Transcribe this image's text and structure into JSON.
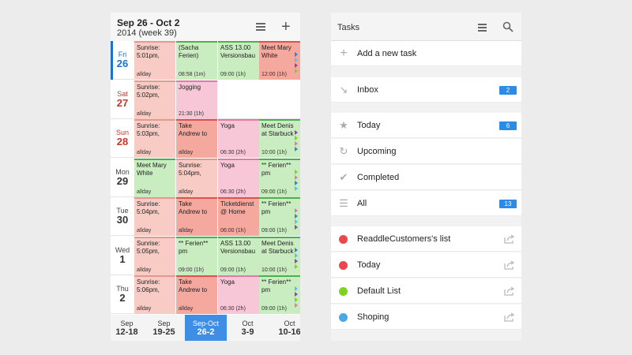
{
  "calendar": {
    "title": "Sep 26 - Oct 2",
    "subtitle": "2014 (week 39)",
    "days": [
      {
        "name": "Fri",
        "num": "26",
        "kind": "today",
        "events": [
          {
            "text": "Sunrise:\n5:01pm,",
            "time": "allday",
            "color": "sun"
          },
          {
            "text": "(Sacha\nFerien)",
            "time": "08:58 (1m)",
            "color": "grn"
          },
          {
            "text": "ASS 13.00\nVersionsbau",
            "time": "09:00 (1h)",
            "color": "grn"
          },
          {
            "text": "Meet Mary\nWhite",
            "time": "12:00 (1h)",
            "color": "red"
          }
        ]
      },
      {
        "name": "Sat",
        "num": "27",
        "kind": "weekend",
        "events": [
          {
            "text": "Sunrise:\n5:02pm,",
            "time": "allday",
            "color": "sun"
          },
          {
            "text": "Jogging",
            "time": "21:30 (1h)",
            "color": "pink"
          }
        ]
      },
      {
        "name": "Sun",
        "num": "28",
        "kind": "weekend",
        "events": [
          {
            "text": "Sunrise:\n5:03pm,",
            "time": "allday",
            "color": "sun"
          },
          {
            "text": "Take\nAndrew to",
            "time": "allday",
            "color": "red"
          },
          {
            "text": "Yoga",
            "time": "06:30 (2h)",
            "color": "pink"
          },
          {
            "text": "Meet Denis\nat Starbuck",
            "time": "10:00 (1h)",
            "color": "grn"
          }
        ]
      },
      {
        "name": "Mon",
        "num": "29",
        "kind": "normal",
        "events": [
          {
            "text": "Meet Mary\nWhite",
            "time": "allday",
            "color": "grn"
          },
          {
            "text": "Sunrise:\n5:04pm,",
            "time": "allday",
            "color": "sun"
          },
          {
            "text": "Yoga",
            "time": "06:30 (2h)",
            "color": "pink"
          },
          {
            "text": "** Ferien**\npm",
            "time": "09:00 (1h)",
            "color": "grn"
          }
        ]
      },
      {
        "name": "Tue",
        "num": "30",
        "kind": "normal",
        "events": [
          {
            "text": "Sunrise:\n5:04pm,",
            "time": "allday",
            "color": "sun"
          },
          {
            "text": "Take\nAndrew to",
            "time": "allday",
            "color": "red"
          },
          {
            "text": "Ticketdienst\n@ Home",
            "time": "06:00 (1h)",
            "color": "red"
          },
          {
            "text": "** Ferien**\npm",
            "time": "09:00 (1h)",
            "color": "grn"
          }
        ]
      },
      {
        "name": "Wed",
        "num": "1",
        "kind": "normal",
        "events": [
          {
            "text": "Sunrise:\n5:05pm,",
            "time": "allday",
            "color": "sun"
          },
          {
            "text": "** Ferien**\npm",
            "time": "09:00 (1h)",
            "color": "grn"
          },
          {
            "text": "ASS 13.00\nVersionsbau",
            "time": "09:00 (1h)",
            "color": "grn"
          },
          {
            "text": "Meet Denis\nat Starbuck",
            "time": "10:00 (1h)",
            "color": "grn"
          }
        ]
      },
      {
        "name": "Thu",
        "num": "2",
        "kind": "normal",
        "events": [
          {
            "text": "Sunrise:\n5:06pm,",
            "time": "allday",
            "color": "sun"
          },
          {
            "text": "Take\nAndrew to",
            "time": "allday",
            "color": "red"
          },
          {
            "text": "Yoga",
            "time": "06:30 (2h)",
            "color": "pink"
          },
          {
            "text": "** Ferien**\npm",
            "time": "09:00 (1h)",
            "color": "grn"
          }
        ]
      }
    ],
    "weeks": [
      {
        "a": "Sep",
        "b": "12-18",
        "active": false
      },
      {
        "a": "Sep",
        "b": "19-25",
        "active": false
      },
      {
        "a": "Sep-Oct",
        "b": "26-2",
        "active": true
      },
      {
        "a": "Oct",
        "b": "3-9",
        "active": false
      },
      {
        "a": "Oct",
        "b": "10-16",
        "active": false
      }
    ]
  },
  "tasks": {
    "title": "Tasks",
    "add_label": "Add a new task",
    "smart_lists": [
      {
        "label": "Inbox",
        "icon": "inbox-icon",
        "badge": "2"
      },
      {
        "label": "Today",
        "icon": "star-icon",
        "badge": "6"
      },
      {
        "label": "Upcoming",
        "icon": "repeat-icon",
        "badge": ""
      },
      {
        "label": "Completed",
        "icon": "check-icon",
        "badge": ""
      },
      {
        "label": "All",
        "icon": "list-icon",
        "badge": "13"
      }
    ],
    "lists": [
      {
        "label": "ReaddleCustomers's list",
        "color": "#e8474e"
      },
      {
        "label": "Today",
        "color": "#e8474e"
      },
      {
        "label": "Default List",
        "color": "#7ed321"
      },
      {
        "label": "Shoping",
        "color": "#4aa8e8"
      }
    ]
  }
}
